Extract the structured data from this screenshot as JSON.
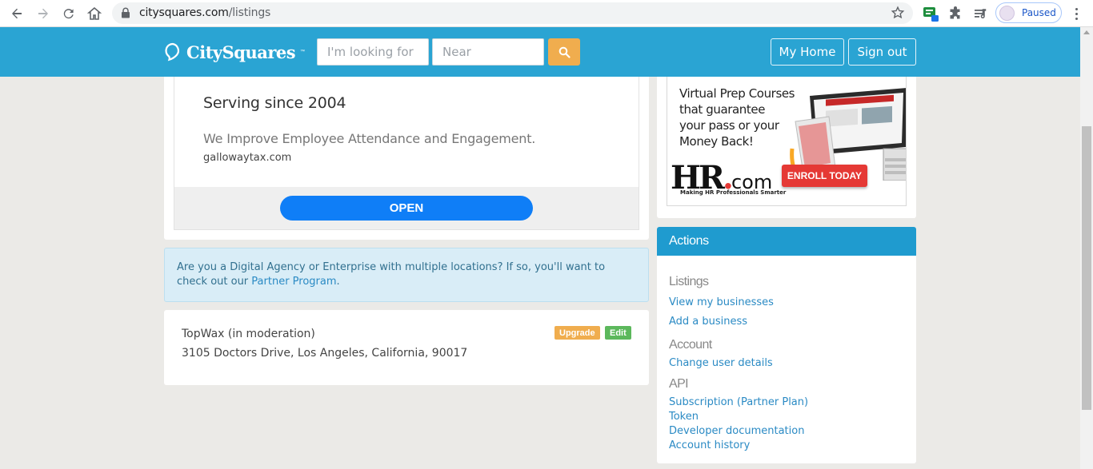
{
  "browser": {
    "url_domain": "citysquares.com",
    "url_path": "/listings",
    "profile_status": "Paused",
    "icons": [
      "back-icon",
      "forward-icon",
      "reload-icon",
      "home-icon",
      "lock-icon",
      "star-icon",
      "extension-badge-icon",
      "puzzle-icon",
      "reading-list-icon",
      "more-icon"
    ]
  },
  "header": {
    "logo_text": "CitySquares",
    "logo_tm": "™",
    "search_placeholder": "I'm looking for",
    "near_placeholder": "Near",
    "my_home_label": "My Home",
    "sign_out_label": "Sign out",
    "brand_color": "#2aa4d3",
    "search_button_color": "#f0ad4e"
  },
  "ad": {
    "title": "Serving since 2004",
    "description": "We Improve Employee Attendance and Engagement.",
    "domain": "gallowaytax.com",
    "open_label": "OPEN"
  },
  "partner": {
    "text_before": "Are you a Digital Agency or Enterprise with multiple locations? If so, you'll want to check out our ",
    "link_label": "Partner Program",
    "text_after": "."
  },
  "listing": {
    "name": "TopWax (in moderation)",
    "address": "3105 Doctors Drive, Los Angeles, California, 90017",
    "upgrade_label": "Upgrade",
    "edit_label": "Edit"
  },
  "banner": {
    "text": "Virtual Prep Courses that guarantee your pass or your Money Back!",
    "line1": "Virtual Prep Courses",
    "line2": "that guarantee",
    "line3": "your pass or your",
    "line4": "Money Back!",
    "logo_main": "HR",
    "logo_dot": ".",
    "logo_tld": "com",
    "tagline": "Making HR Professionals Smarter",
    "cta": "ENROLL TODAY"
  },
  "actions": {
    "title": "Actions",
    "sections": [
      {
        "title": "Listings",
        "links": [
          "View my businesses",
          "Add a business"
        ]
      },
      {
        "title": "Account",
        "links": [
          "Change user details"
        ]
      },
      {
        "title": "API",
        "links": [
          "Subscription (Partner Plan)",
          "Token",
          "Developer documentation",
          "Account history"
        ]
      }
    ]
  }
}
